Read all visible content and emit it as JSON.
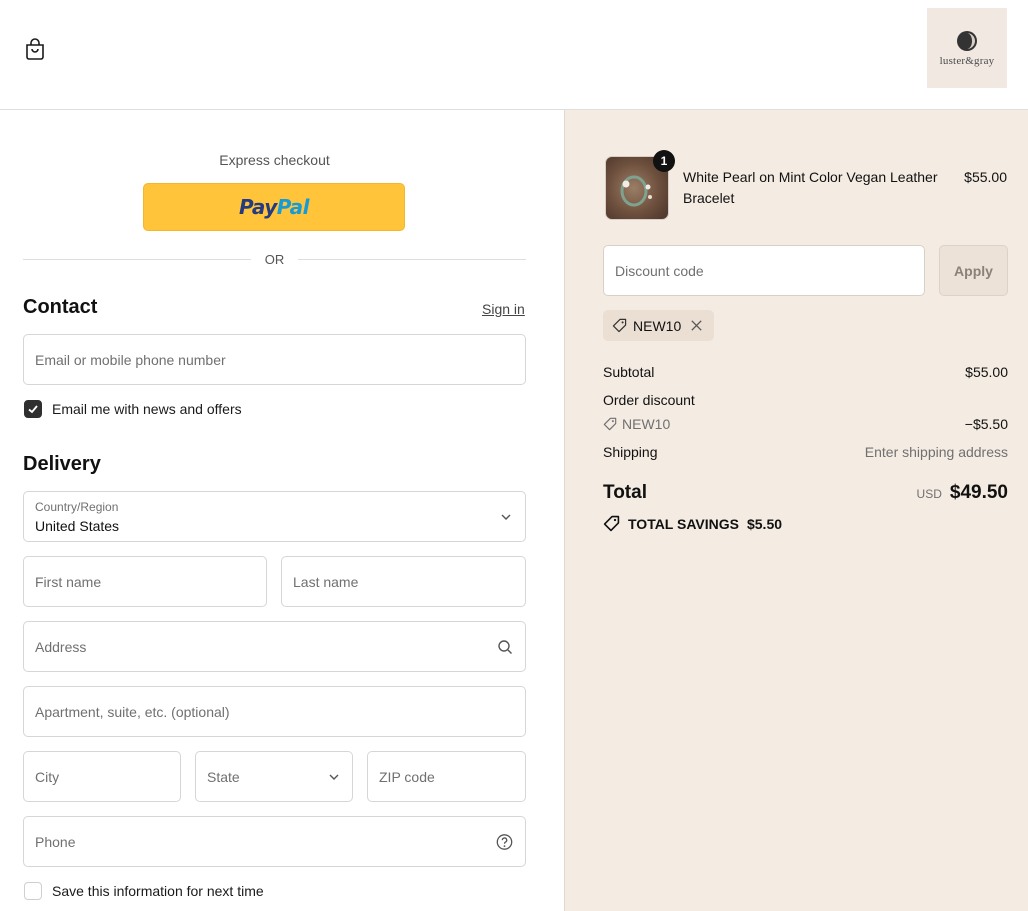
{
  "header": {
    "logo_text": "luster&gray"
  },
  "express": {
    "label": "Express checkout",
    "paypal_part1": "Pay",
    "paypal_part2": "Pal",
    "or_label": "OR"
  },
  "contact": {
    "title": "Contact",
    "sign_in": "Sign in",
    "email_placeholder": "Email or mobile phone number",
    "newsletter_label": "Email me with news and offers",
    "newsletter_checked": true
  },
  "delivery": {
    "title": "Delivery",
    "country_label": "Country/Region",
    "country_value": "United States",
    "first_name": "First name",
    "last_name": "Last name",
    "address": "Address",
    "apartment": "Apartment, suite, etc. (optional)",
    "city": "City",
    "state": "State",
    "zip": "ZIP code",
    "phone": "Phone",
    "save_info_label": "Save this information for next time",
    "save_info_checked": false
  },
  "summary": {
    "product": {
      "name": "White Pearl on Mint Color Vegan Leather Bracelet",
      "price": "$55.00",
      "quantity": "1"
    },
    "discount_placeholder": "Discount code",
    "apply_label": "Apply",
    "applied_code": "NEW10",
    "subtotal_label": "Subtotal",
    "subtotal_value": "$55.00",
    "order_discount_label": "Order discount",
    "discount_code": "NEW10",
    "discount_value": "−$5.50",
    "shipping_label": "Shipping",
    "shipping_value": "Enter shipping address",
    "total_label": "Total",
    "total_currency": "USD",
    "total_value": "$49.50",
    "savings_label": "TOTAL SAVINGS",
    "savings_value": "$5.50"
  },
  "colors": {
    "summary_bg": "#f4ebe2",
    "paypal_yellow": "#ffc439",
    "paypal_navy": "#253b80",
    "paypal_blue": "#179bd7"
  }
}
